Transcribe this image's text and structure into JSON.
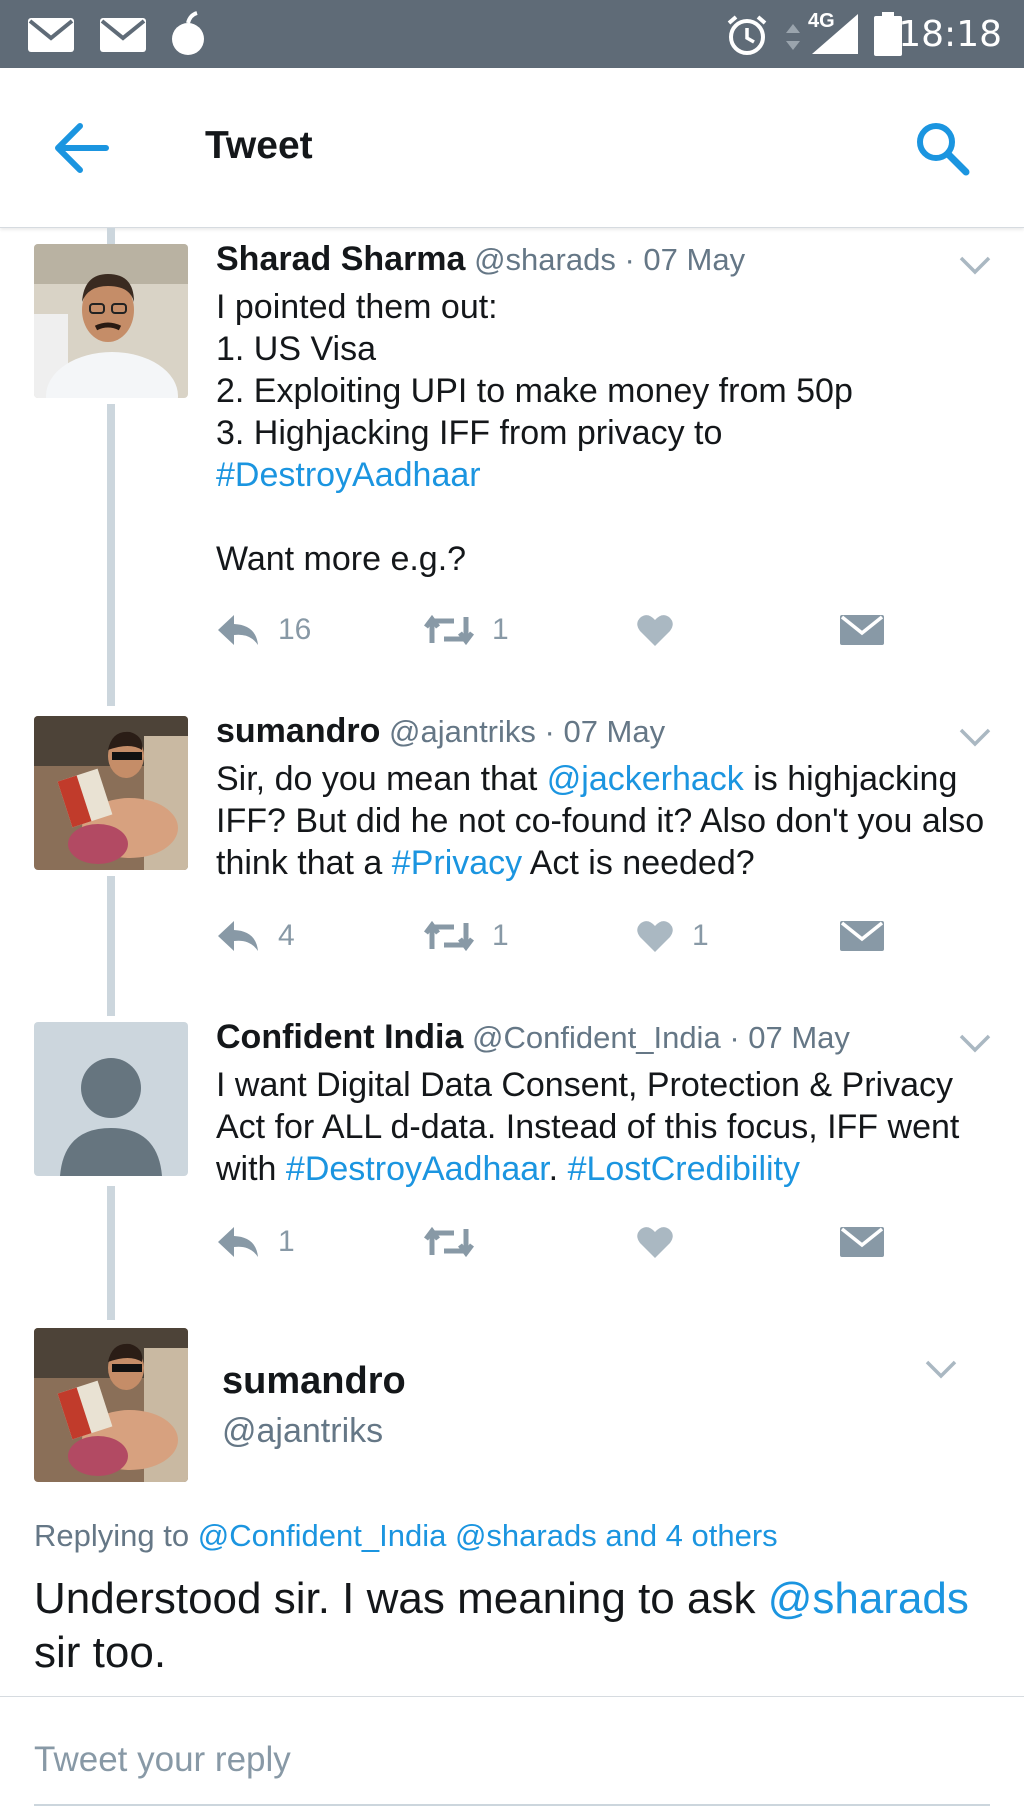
{
  "status_bar": {
    "time": "18:18",
    "network": "4G",
    "icons": [
      "mail-icon",
      "mail-icon",
      "app-notification-icon",
      "alarm-icon",
      "signal-icon",
      "battery-icon"
    ]
  },
  "header": {
    "title": "Tweet",
    "back_icon": "arrow-left-icon",
    "search_icon": "search-icon"
  },
  "colors": {
    "status_bar": "#5f6b77",
    "link": "#1b95e0",
    "muted": "#657786",
    "icon_gray": "#8899a6",
    "thread_line": "#ccd6dd"
  },
  "tweets": [
    {
      "name": "Sharad Sharma",
      "handle": "@sharads",
      "date": "· 07 May",
      "lines": [
        "I pointed them out:",
        "1. US Visa",
        "2. Exploiting UPI to make money from 50p",
        "3. Highjacking IFF from privacy to"
      ],
      "hashtag": "#DestroyAadhaar",
      "followup": "Want more e.g.?",
      "replies": "16",
      "retweets": "1",
      "likes": ""
    },
    {
      "name": "sumandro",
      "handle": "@ajantriks",
      "date": "· 07 May",
      "text_1": "Sir, do you mean that ",
      "mention": "@jackerhack",
      "text_2": " is highjacking IFF? But did he not co-found it? Also don't you also think that a ",
      "hashtag": "#Privacy",
      "text_3": " Act is needed?",
      "replies": "4",
      "retweets": "1",
      "likes": "1"
    },
    {
      "name": "Confident India",
      "handle": "@Confident_India",
      "date": "· 07 May",
      "text_1": "I want Digital Data Consent, Protection & Privacy Act for ALL d-data. Instead of this focus, IFF went with ",
      "hashtag_1": "#DestroyAadhaar",
      "text_2": ". ",
      "hashtag_2": "#LostCredibility",
      "replies": "1",
      "retweets": "",
      "likes": ""
    }
  ],
  "focused": {
    "name": "sumandro",
    "handle": "@ajantriks",
    "replying_label": "Replying to ",
    "replying_to": "@Confident_India @sharads and 4 others",
    "text_1": "Understood sir. I was meaning to ask ",
    "mention": "@sharads",
    "text_2": " sir too."
  },
  "reply_box": {
    "placeholder": "Tweet your reply"
  }
}
